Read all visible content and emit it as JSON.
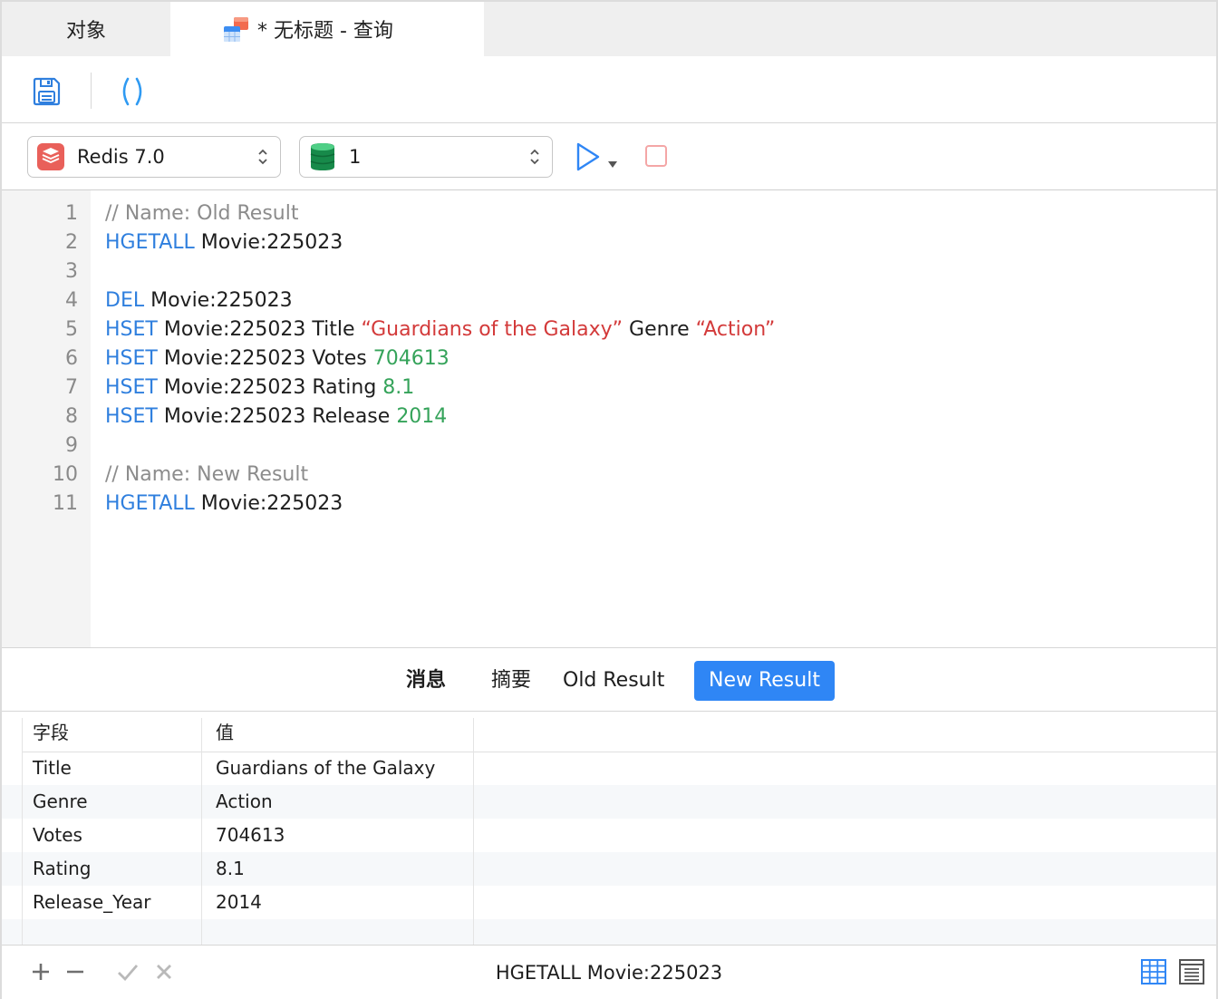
{
  "tabs": {
    "objects_label": "对象",
    "query_label": "* 无标题 - 查询"
  },
  "selectors": {
    "connection": "Redis 7.0",
    "database": "1"
  },
  "editor": {
    "lines": [
      {
        "n": "1",
        "tokens": [
          {
            "t": "cm",
            "v": "// Name: Old Result"
          }
        ]
      },
      {
        "n": "2",
        "tokens": [
          {
            "t": "kw",
            "v": "HGETALL"
          },
          {
            "t": "tx",
            "v": " Movie:225023"
          }
        ]
      },
      {
        "n": "3",
        "tokens": []
      },
      {
        "n": "4",
        "tokens": [
          {
            "t": "kw",
            "v": "DEL"
          },
          {
            "t": "tx",
            "v": " Movie:225023"
          }
        ]
      },
      {
        "n": "5",
        "tokens": [
          {
            "t": "kw",
            "v": "HSET"
          },
          {
            "t": "tx",
            "v": " Movie:225023 Title "
          },
          {
            "t": "str",
            "v": "“Guardians of the Galaxy”"
          },
          {
            "t": "tx",
            "v": " Genre "
          },
          {
            "t": "str",
            "v": "“Action”"
          }
        ]
      },
      {
        "n": "6",
        "tokens": [
          {
            "t": "kw",
            "v": "HSET"
          },
          {
            "t": "tx",
            "v": " Movie:225023 Votes "
          },
          {
            "t": "num",
            "v": "704613"
          }
        ]
      },
      {
        "n": "7",
        "tokens": [
          {
            "t": "kw",
            "v": "HSET"
          },
          {
            "t": "tx",
            "v": " Movie:225023 Rating "
          },
          {
            "t": "num",
            "v": "8.1"
          }
        ]
      },
      {
        "n": "8",
        "tokens": [
          {
            "t": "kw",
            "v": "HSET"
          },
          {
            "t": "tx",
            "v": " Movie:225023 Release "
          },
          {
            "t": "num",
            "v": "2014"
          }
        ]
      },
      {
        "n": "9",
        "tokens": []
      },
      {
        "n": "10",
        "tokens": [
          {
            "t": "cm",
            "v": "// Name: New Result"
          }
        ]
      },
      {
        "n": "11",
        "tokens": [
          {
            "t": "kw",
            "v": "HGETALL"
          },
          {
            "t": "tx",
            "v": " Movie:225023"
          }
        ]
      }
    ]
  },
  "result_tabs": {
    "messages": "消息",
    "summary": "摘要",
    "old_result": "Old Result",
    "new_result": "New Result",
    "active": "New Result"
  },
  "grid": {
    "headers": [
      "字段",
      "值"
    ],
    "rows": [
      [
        "Title",
        "Guardians of the Galaxy"
      ],
      [
        "Genre",
        "Action"
      ],
      [
        "Votes",
        "704613"
      ],
      [
        "Rating",
        "8.1"
      ],
      [
        "Release_Year",
        "2014"
      ]
    ]
  },
  "status": {
    "query_text": "HGETALL Movie:225023"
  },
  "colors": {
    "accent": "#2f86f5",
    "keyword": "#2f7fde",
    "string": "#d33a3a",
    "number": "#35a35a",
    "comment": "#8c8c8c"
  }
}
